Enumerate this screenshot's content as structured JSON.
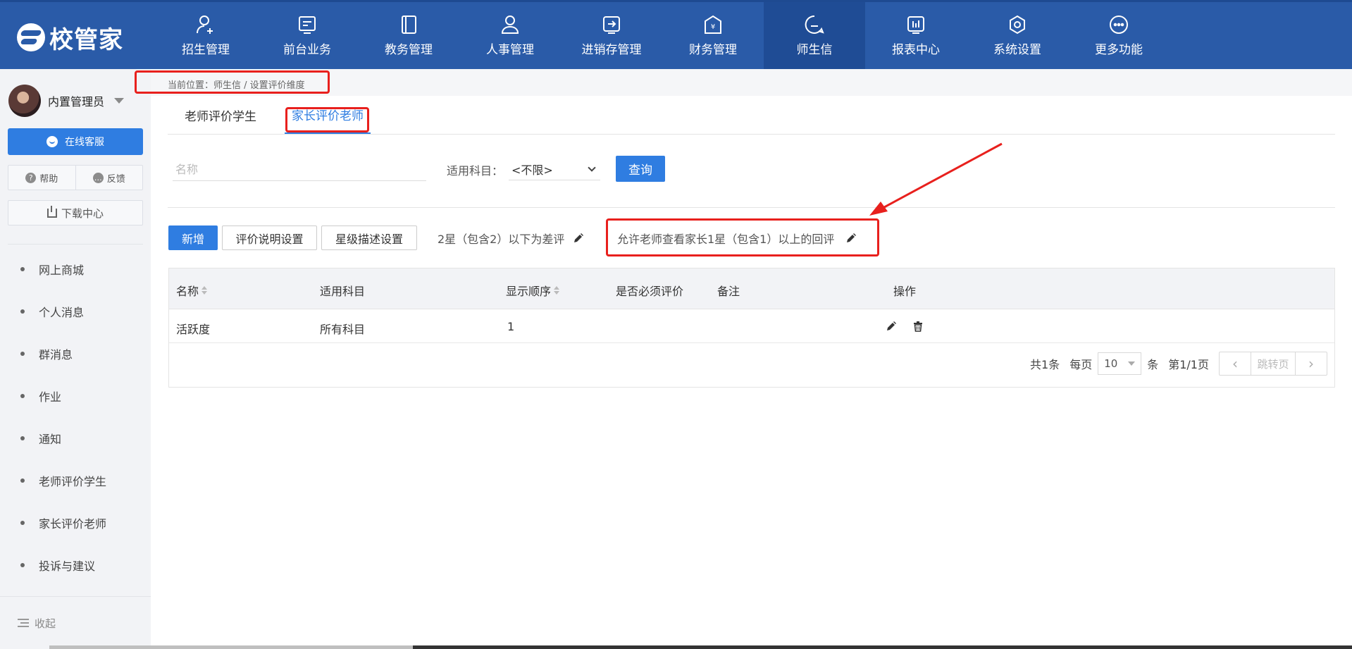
{
  "app": {
    "logo_text": "校管家"
  },
  "nav": [
    {
      "label": "招生管理",
      "icon": "user-plus-icon"
    },
    {
      "label": "前台业务",
      "icon": "message-box-icon"
    },
    {
      "label": "教务管理",
      "icon": "book-icon"
    },
    {
      "label": "人事管理",
      "icon": "person-icon"
    },
    {
      "label": "进销存管理",
      "icon": "arrow-box-icon"
    },
    {
      "label": "财务管理",
      "icon": "yen-house-icon"
    },
    {
      "label": "师生信",
      "icon": "chat-bubble-icon",
      "active": true
    },
    {
      "label": "报表中心",
      "icon": "bar-chart-icon"
    },
    {
      "label": "系统设置",
      "icon": "gear-hex-icon"
    },
    {
      "label": "更多功能",
      "icon": "ellipsis-circle-icon"
    }
  ],
  "sidebar": {
    "user_name": "内置管理员",
    "service_label": "在线客服",
    "help_label": "帮助",
    "feedback_label": "反馈",
    "download_label": "下载中心",
    "menu": [
      "网上商城",
      "个人消息",
      "群消息",
      "作业",
      "通知",
      "老师评价学生",
      "家长评价老师",
      "投诉与建议"
    ],
    "collapse_label": "收起"
  },
  "breadcrumb": "当前位置：师生信 / 设置评价维度",
  "tabs": [
    {
      "label": "老师评价学生",
      "active": false
    },
    {
      "label": "家长评价老师",
      "active": true
    }
  ],
  "filters": {
    "name_placeholder": "名称",
    "subject_label": "适用科目：",
    "subject_value": "<不限>",
    "query_label": "查询"
  },
  "toolbar": {
    "add_label": "新增",
    "desc_settings_label": "评价说明设置",
    "star_settings_label": "星级描述设置",
    "bad_rule_text": "2星（包含2）以下为差评",
    "allow_rule_text": "允许老师查看家长1星（包含1）以上的回评"
  },
  "table": {
    "columns": [
      "名称",
      "适用科目",
      "显示顺序",
      "是否必须评价",
      "备注",
      "操作"
    ],
    "rows": [
      {
        "name": "活跃度",
        "subject": "所有科目",
        "order": "1",
        "required": "",
        "remark": ""
      }
    ]
  },
  "pager": {
    "total": "共1条",
    "per_page_label": "每页",
    "per_page_value": "10",
    "unit": "条",
    "page_info": "第1/1页",
    "jump_label": "跳转页",
    "prev_icon": "chevron-left-icon",
    "next_icon": "chevron-right-icon"
  },
  "colors": {
    "nav_bg": "#2a5ba8",
    "primary": "#2f7de1",
    "annotation_red": "#e8201d"
  }
}
